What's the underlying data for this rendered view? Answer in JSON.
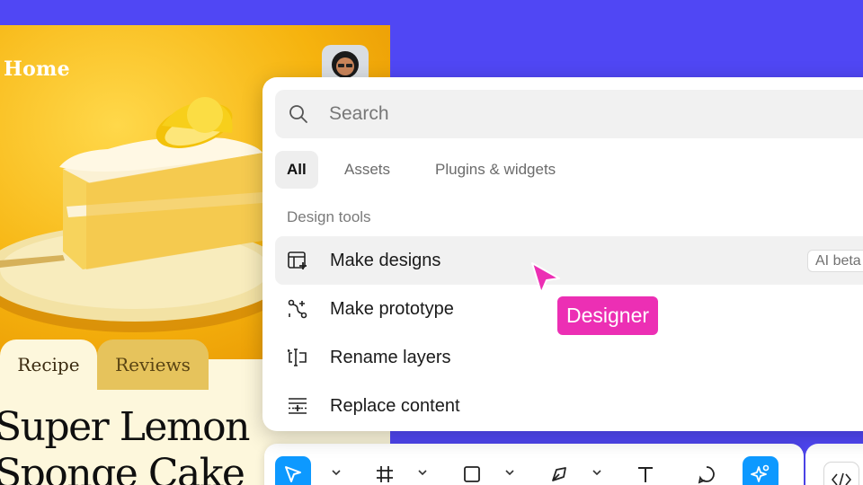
{
  "recipe": {
    "home_title": "Home",
    "tabs": [
      {
        "label": "Recipe",
        "active": true
      },
      {
        "label": "Reviews",
        "active": false
      }
    ],
    "title_line1": "Super Lemon",
    "title_line2": "Sponge Cake"
  },
  "palette": {
    "search": {
      "placeholder": "Search",
      "value": "",
      "icon": "search-icon"
    },
    "filters": [
      {
        "label": "All",
        "active": true
      },
      {
        "label": "Assets",
        "active": false
      },
      {
        "label": "Plugins & widgets",
        "active": false
      }
    ],
    "section_label": "Design tools",
    "items": [
      {
        "label": "Make designs",
        "icon": "make-designs-icon",
        "badge": "AI beta",
        "highlighted": true
      },
      {
        "label": "Make prototype",
        "icon": "make-prototype-icon"
      },
      {
        "label": "Rename layers",
        "icon": "rename-layers-icon"
      },
      {
        "label": "Replace content",
        "icon": "replace-content-icon"
      }
    ]
  },
  "cursor": {
    "label": "Designer",
    "color": "#ec2fb4"
  },
  "toolbar": {
    "tools": [
      "move-tool-icon",
      "frame-tool-icon",
      "rectangle-tool-icon",
      "pen-tool-icon",
      "text-tool-icon",
      "comment-tool-icon",
      "actions-tool-icon"
    ],
    "active_color": "#0d99ff",
    "code_icon": "code-icon"
  },
  "colors": {
    "background": "#5047f4",
    "card": "#fdf7dc",
    "reviews_tab": "#e6c35c",
    "accent": "#0d99ff",
    "cursor_pink": "#ec2fb4"
  }
}
